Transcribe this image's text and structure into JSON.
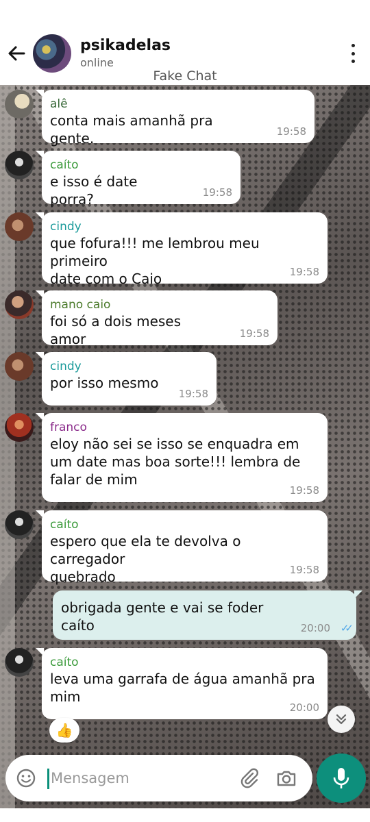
{
  "header": {
    "name": "psikadelas",
    "status": "online",
    "watermark": "Fake Chat"
  },
  "colors": {
    "accent": "#0d8f7c",
    "outgoing_bubble": "#dcefed",
    "incoming_bubble": "#ffffff",
    "read_ticks": "#4fa6e8"
  },
  "messages": [
    {
      "sender": "alê",
      "sender_color": "#3a6a3a",
      "lines": [
        "conta mais amanhã pra gente."
      ],
      "time": "19:58"
    },
    {
      "sender": "caíto",
      "sender_color": "#3a9a3a",
      "lines": [
        "e isso é date porra?"
      ],
      "time": "19:58"
    },
    {
      "sender": "cindy",
      "sender_color": "#1a9a9a",
      "lines": [
        "que fofura!!! me lembrou meu primeiro",
        "date com o Caio"
      ],
      "time": "19:58"
    },
    {
      "sender": "mano caio",
      "sender_color": "#4a7a2a",
      "lines": [
        "foi só a dois meses amor"
      ],
      "time": "19:58"
    },
    {
      "sender": "cindy",
      "sender_color": "#1a9a9a",
      "lines": [
        "por isso mesmo"
      ],
      "time": "19:58"
    },
    {
      "sender": "franco",
      "sender_color": "#8a2a8a",
      "lines": [
        "eloy não sei se isso se enquadra em",
        "um date mas boa sorte!!! lembra de",
        "falar de mim"
      ],
      "time": "19:58"
    },
    {
      "sender": "caíto",
      "sender_color": "#3a9a3a",
      "lines": [
        "espero que ela te devolva o carregador",
        "quebrado"
      ],
      "time": "19:58"
    },
    {
      "outgoing": true,
      "lines": [
        "obrigada gente e vai se foder caíto"
      ],
      "time": "20:00"
    },
    {
      "sender": "caíto",
      "sender_color": "#3a9a3a",
      "lines": [
        "leva uma garrafa de água amanhã pra",
        "mim"
      ],
      "time": "20:00",
      "reaction": "👍"
    }
  ],
  "input": {
    "placeholder": "Mensagem"
  }
}
